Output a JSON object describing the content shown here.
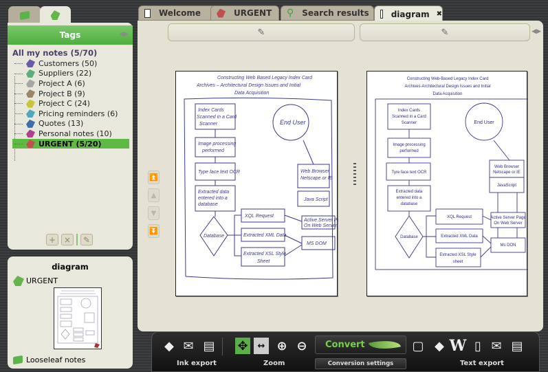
{
  "left_tabs": [
    {
      "icon": "notebook-icon"
    },
    {
      "icon": "tags-icon"
    }
  ],
  "tags_panel": {
    "title": "Tags",
    "root": "All my notes (5/70)",
    "items": [
      {
        "label": "Customers (50)",
        "color": "#6a5aa8"
      },
      {
        "label": "Suppliers (22)",
        "color": "#5cae7a"
      },
      {
        "label": "Project A (6)",
        "color": "#a7a7a7"
      },
      {
        "label": "Project B (9)",
        "color": "#9c8466"
      },
      {
        "label": "Project C (24)",
        "color": "#c9c43c"
      },
      {
        "label": "Pricing reminders (6)",
        "color": "#4ea7bd"
      },
      {
        "label": "Quotes (13)",
        "color": "#3f6db0"
      },
      {
        "label": "Personal notes (10)",
        "color": "#b33e8e"
      },
      {
        "label": "URGENT (5/20)",
        "color": "#c0504d",
        "selected": true
      }
    ],
    "actions": {
      "add": "+",
      "delete": "×",
      "edit": "✎"
    }
  },
  "note_detail": {
    "title": "diagram",
    "tag": "URGENT",
    "notebook": "Looseleaf notes"
  },
  "tabs": [
    {
      "label": "Welcome",
      "icon": "page-icon"
    },
    {
      "label": "URGENT",
      "icon": "tag-icon"
    },
    {
      "label": "Search results",
      "icon": "search-icon"
    },
    {
      "label": "diagram",
      "icon": "page-icon",
      "active": true,
      "close": "✖"
    }
  ],
  "pen_bars": {
    "left": "✎",
    "right": "✎"
  },
  "nav_buttons": [
    "⏫",
    "▲",
    "▼",
    "⏬"
  ],
  "typed_page": {
    "title_lines": [
      "Constructing Web-Based Legacy Index Card",
      "Archives-Architectural Design Issues and Initial",
      "Data Acquisition"
    ],
    "boxes": {
      "scan": [
        "Index Cards",
        "Scanned in a Card",
        "Scanner"
      ],
      "img": [
        "Image processing",
        "performed"
      ],
      "ocr": [
        "Tyre face text OCR"
      ],
      "extract": [
        "Extracted data",
        "entered into a",
        "database"
      ],
      "db": "Database",
      "xql": "XQL Request",
      "xml": "Extracted XML Data",
      "xsl": [
        "Extracted XSL Style",
        "sheet"
      ],
      "user": "End User",
      "browser": [
        "Web Browser",
        "Netscape or IE"
      ],
      "js": "JavaScript",
      "asp": [
        "Active Server Page",
        "On Web Server"
      ],
      "dom": "Ms DON"
    }
  },
  "toolbar": {
    "ink_export_label": "Ink export",
    "zoom_label": "Zoom",
    "convert_label": "Convert",
    "conversion_settings_label": "Conversion settings",
    "text_export_label": "Text export",
    "icons": {
      "shapes": "◆",
      "mail": "✉",
      "print": "▤",
      "fit_page": "✥",
      "fit_width": "↔",
      "zoom_in": "⊕",
      "zoom_out": "⊖",
      "frame": "▢",
      "shapes2": "◆",
      "word": "W",
      "notepad": "▯",
      "mail2": "✉",
      "print2": "▤"
    }
  }
}
